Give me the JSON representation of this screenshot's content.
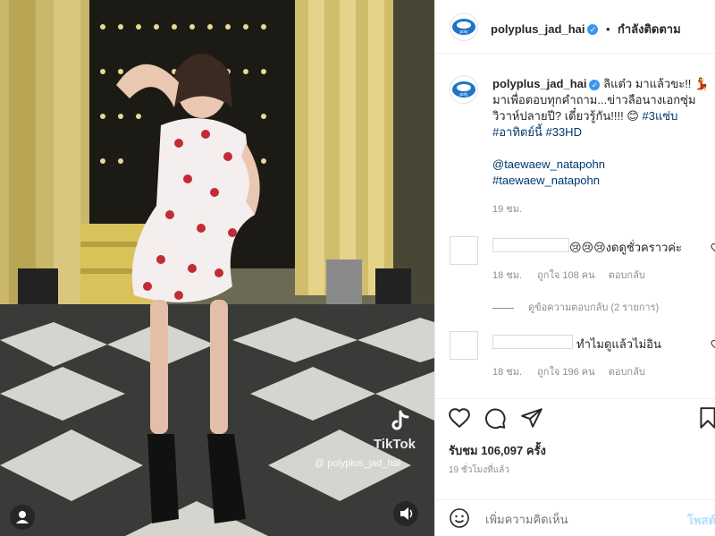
{
  "post": {
    "username": "polyplus_jad_hai",
    "follow_status": "กำลังติดตาม",
    "separator": "•",
    "caption_plain": "ลิแต๋ว มาแล้วขะ!! 💃 มาเพื่อตอบทุกคำถาม...ข่าวลือนางเอกซุ่มวิวาห์ปลายปี? เดี๋ยวรู้กัน!!!! 😊",
    "caption_tag1": "#3แซ่บ",
    "caption_tag2": "#อาทิตย์นี้",
    "caption_tag3": "#33HD",
    "mention": "@taewaew_natapohn",
    "hashtag_person": "#taewaew_natapohn",
    "caption_time": "19 ชม.",
    "likes": "รับชม 106,097 ครั้ง",
    "time_ago": "19 ชั่วโมงที่แล้ว",
    "add_comment_placeholder": "เพิ่มความคิดเห็น",
    "post_button": "โพสต์"
  },
  "comments": [
    {
      "text": "😢😢😢งดดูชั่วคราวค่ะ",
      "time": "18 ชม.",
      "likes": "ถูกใจ 108 คน",
      "reply": "ตอบกลับ",
      "view_replies": "ดูข้อความตอบกลับ (2 รายการ)"
    },
    {
      "text": "ทำไมดูแล้วไม่อิน",
      "time": "18 ชม.",
      "likes": "ถูกใจ 196 คน",
      "reply": "ตอบกลับ"
    }
  ],
  "video": {
    "watermark_brand": "TikTok",
    "watermark_user": "@ polyplus_jad_hai"
  },
  "colors": {
    "verified": "#3897f0",
    "link": "#00376b",
    "post_button": "#b2dffc"
  },
  "icons": {
    "like": "heart-icon",
    "comment": "comment-icon",
    "share": "send-icon",
    "save": "bookmark-icon",
    "emoji": "emoji-icon",
    "more": "more-options-icon",
    "audio": "volume-icon",
    "user": "tagged-user-icon"
  }
}
